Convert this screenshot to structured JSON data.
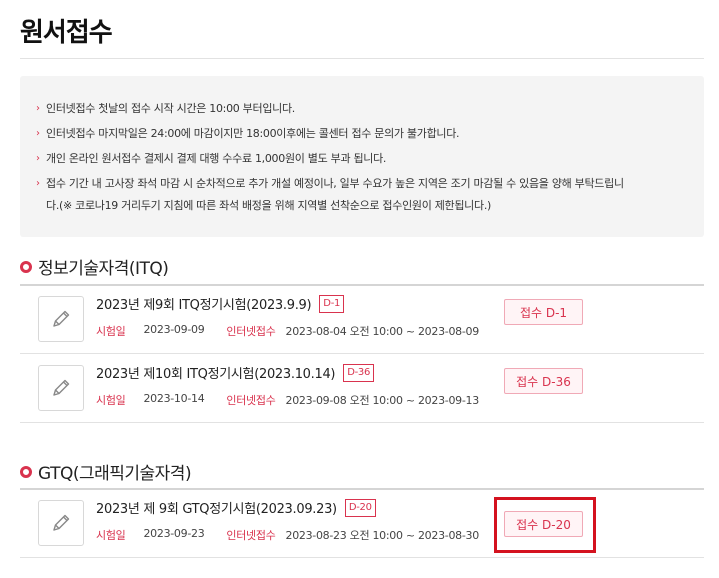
{
  "page": {
    "title": "원서접수"
  },
  "notices": [
    "인터넷접수 첫날의 접수 시작 시간은 10:00 부터입니다.",
    "인터넷접수 마지막일은 24:00에 마감이지만 18:00이후에는 콜센터 접수 문의가 불가합니다.",
    "개인 온라인 원서접수 결제시 결제 대행 수수료 1,000원이 별도 부과 됩니다.",
    "접수 기간 내 고사장 좌석 마감 시 순차적으로 추가 개설 예정이나, 일부 수요가 높은 지역은 조기 마감될 수 있음을 양해 부탁드립니",
    "다.(※ 코로나19 거리두기 지침에 따른 좌석 배정을 위해 지역별 선착순으로 접수인원이 제한됩니다.)"
  ],
  "bullet_glyph": "›",
  "labels": {
    "exam_date": "시험일",
    "internet_apply": "인터넷접수"
  },
  "sections": [
    {
      "title": "정보기술자격(ITQ)",
      "exams": [
        {
          "name": "2023년 제9회 ITQ정기시험(2023.9.9)",
          "dday": "D-1",
          "exam_date": "2023-09-09",
          "apply_period": "2023-08-04 오전 10:00 ~ 2023-08-09",
          "button": "접수 D-1"
        },
        {
          "name": "2023년 제10회 ITQ정기시험(2023.10.14)",
          "dday": "D-36",
          "exam_date": "2023-10-14",
          "apply_period": "2023-09-08 오전 10:00 ~ 2023-09-13",
          "button": "접수 D-36"
        }
      ]
    },
    {
      "title": "GTQ(그래픽기술자격)",
      "exams": [
        {
          "name": "2023년 제 9회 GTQ정기시험(2023.09.23)",
          "dday": "D-20",
          "exam_date": "2023-09-23",
          "apply_period": "2023-08-23 오전 10:00 ~ 2023-08-30",
          "button": "접수 D-20"
        }
      ]
    }
  ],
  "colors": {
    "accent": "#d9334e",
    "highlight": "#d4121f",
    "notice_bg": "#f4f4f4"
  },
  "icons": {
    "exam_icon": "pencil-icon",
    "section_icon": "circle-bullet-icon"
  }
}
